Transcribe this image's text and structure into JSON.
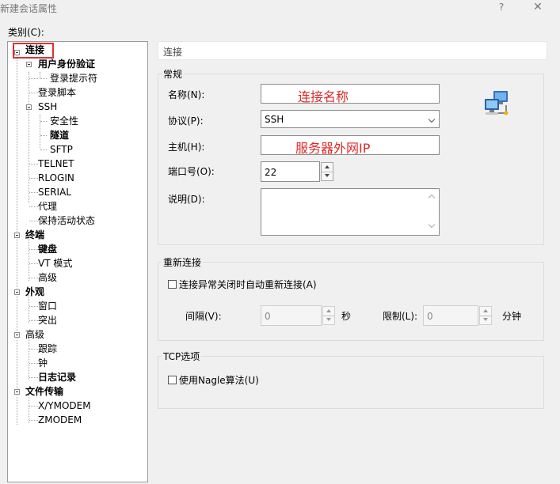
{
  "window": {
    "title": "新建会话属性",
    "help": "?",
    "close": "✕"
  },
  "category_label": "类别(C):",
  "tree": {
    "connection": "连接",
    "user_auth": "用户身份验证",
    "login_prompt": "登录提示符",
    "login_script": "登录脚本",
    "ssh": "SSH",
    "security": "安全性",
    "tunnel": "隧道",
    "sftp": "SFTP",
    "telnet": "TELNET",
    "rlogin": "RLOGIN",
    "serial": "SERIAL",
    "proxy": "代理",
    "keepalive": "保持活动状态",
    "terminal": "终端",
    "keyboard": "键盘",
    "vt_mode": "VT 模式",
    "advanced": "高级",
    "appearance": "外观",
    "window_item": "窗口",
    "highlight": "突出",
    "advanced2": "高级",
    "trace": "跟踪",
    "bell": "钟",
    "logging": "日志记录",
    "file_transfer": "文件传输",
    "xymodem": "X/YMODEM",
    "zmodem": "ZMODEM"
  },
  "breadcrumb": "连接",
  "general": {
    "title": "常规",
    "name_label": "名称(N):",
    "name_value": "连接名称",
    "protocol_label": "协议(P):",
    "protocol_value": "SSH",
    "host_label": "主机(H):",
    "host_value": "服务器外网IP",
    "port_label": "端口号(O):",
    "port_value": "22",
    "desc_label": "说明(D):"
  },
  "reconnect": {
    "title": "重新连接",
    "auto_label": "连接异常关闭时自动重新连接(A)",
    "interval_label": "间隔(V):",
    "interval_value": "0",
    "interval_unit": "秒",
    "limit_label": "限制(L):",
    "limit_value": "0",
    "limit_unit": "分钟"
  },
  "tcp": {
    "title": "TCP选项",
    "nagle_label": "使用Nagle算法(U)"
  },
  "accent_color": "#e03030"
}
